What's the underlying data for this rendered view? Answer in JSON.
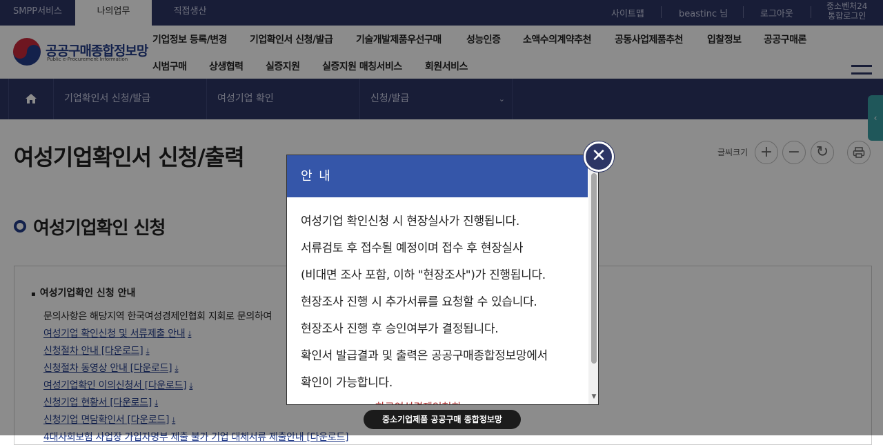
{
  "topbar": {
    "tabs": [
      "SMPP서비스",
      "나의업무",
      "직접생산"
    ],
    "links": [
      "사이트맵",
      "beastinc 님",
      "로그아웃"
    ],
    "sso_line1": "중소벤처24",
    "sso_line2": "통합로그인"
  },
  "header": {
    "logo_text": "공공구매종합정보망",
    "logo_sub": "Public e-Procurement Information",
    "gnb": [
      "기업정보 등록/변경",
      "기업확인서 신청/발급",
      "기술개발제품우선구매",
      "성능인증",
      "소액수의계약추천",
      "공동사업제품추천",
      "입찰정보",
      "공공구매론",
      "시범구매",
      "상생협력",
      "실증지원",
      "실증지원 매칭서비스",
      "회원서비스"
    ]
  },
  "breadcrumb": {
    "home_icon": "home-icon",
    "items": [
      "기업확인서 신청/발급",
      "여성기업 확인",
      "신청/발급"
    ]
  },
  "page": {
    "title": "여성기업확인서 신청/출력",
    "fontsize_label": "글씨크기",
    "section_title": "여성기업확인 신청"
  },
  "info": {
    "heading": "여성기업확인 신청 안내",
    "contact": "문의사항은 해당지역 한국여성경제인협회 지회로 문의하여",
    "links": [
      "여성기업 확인신청 및 서류제출 안내",
      "신청절차 안내 [다운로드]",
      "신청절차 동영상 안내 [다운로드]",
      "여성기업확인 이의신청서 [다운로드]",
      "신청기업 현황서 [다운로드]",
      "신청기업 면담확인서 [다운로드]",
      "4대사회보험 사업장 가입자명부 제출 불가 기업 대체서류 제출안내 [다운로드]"
    ],
    "download_icon": "download-arrow-icon"
  },
  "modal": {
    "title": "안 내",
    "lines": [
      "여성기업 확인신청 시 현장실사가 진행됩니다.",
      "서류검토 후 접수될 예정이며 접수 후 현장실사",
      "(비대면 조사 포함, 이하 \"현장조사\")가 진행됩니다.",
      "현장조사 진행 시 추가서류를 요청할 수 있습니다.",
      "현장조사 진행 후 승인여부가 결정됩니다.",
      "확인서 발급결과 및 출력은 공공구매종합정보망에서",
      "확인이 가능합니다."
    ],
    "peek": "한국여성경제인협회"
  },
  "toast": "중소기업제품 공공구매 종합정보망",
  "colors": {
    "navy": "#2c3565",
    "modal_header": "#3556a9",
    "teal": "#3a9ea5"
  }
}
